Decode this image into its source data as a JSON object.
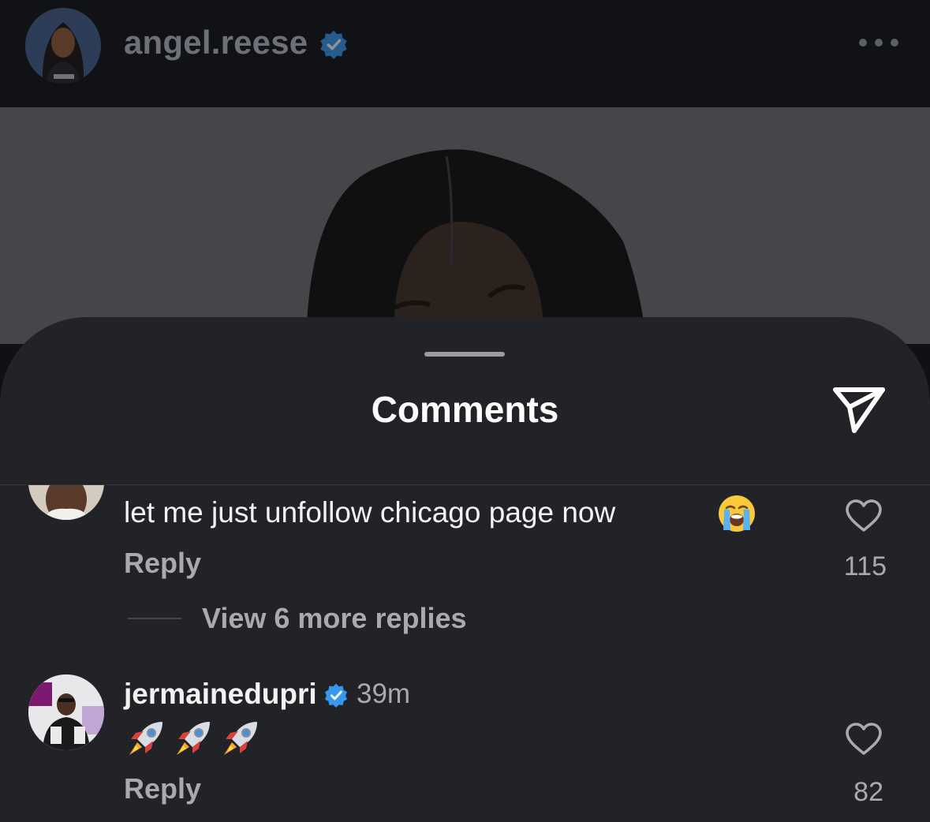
{
  "post": {
    "username": "angel.reese",
    "verified": true,
    "more_icon": "more-horizontal-icon"
  },
  "sheet": {
    "title": "Comments",
    "share_icon": "send-icon"
  },
  "comments": [
    {
      "text": "let me just unfollow chicago page now",
      "emoji": "loudly-crying-face",
      "reply_label": "Reply",
      "likes": "115",
      "view_replies": "View 6 more replies"
    },
    {
      "username": "jermainedupri",
      "verified": true,
      "time": "39m",
      "emoji": [
        "rocket",
        "rocket",
        "rocket"
      ],
      "reply_label": "Reply",
      "likes": "82"
    }
  ],
  "colors": {
    "verified_blue": "#3897f0",
    "sheet_bg": "#222327",
    "muted_text": "#a8aab0"
  }
}
